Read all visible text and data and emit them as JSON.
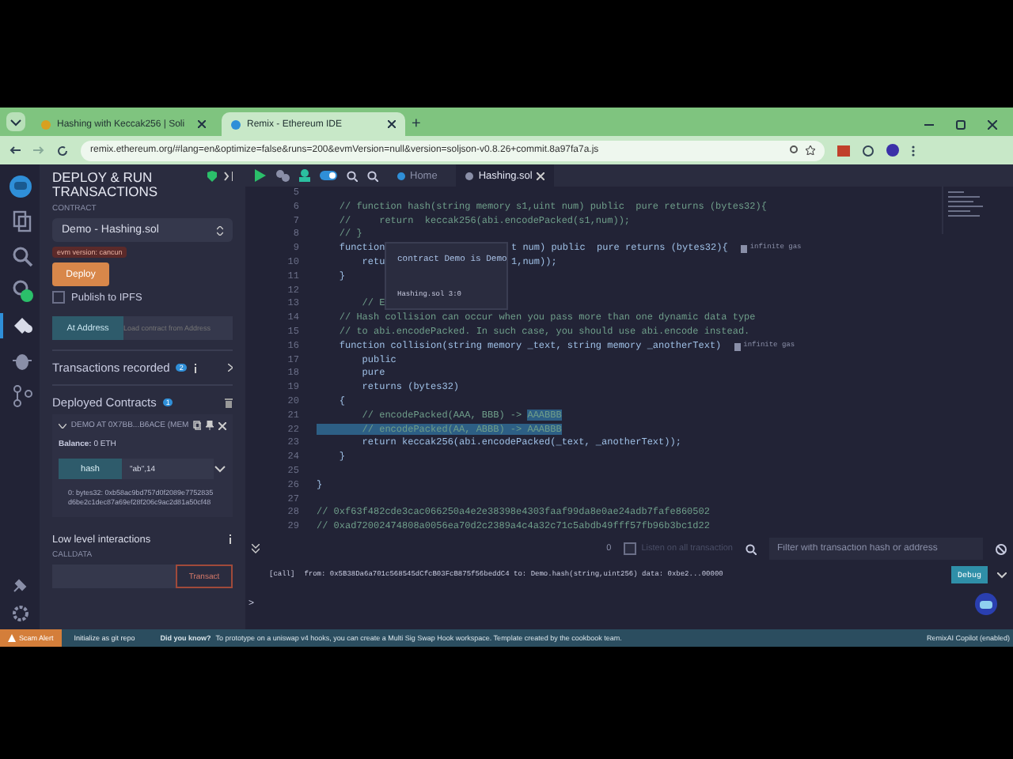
{
  "browser": {
    "tabs": [
      {
        "title": "Hashing with Keccak256 | Soli",
        "selected": false
      },
      {
        "title": "Remix - Ethereum IDE",
        "selected": true
      }
    ],
    "new_tab": "+",
    "url": "remix.ethereum.org/#lang=en&optimize=false&runs=200&evmVersion=null&version=soljson-v0.8.26+commit.8a97fa7a.js"
  },
  "activity_bar": [
    {
      "kind": "files",
      "selected": false
    },
    {
      "kind": "search",
      "selected": false
    },
    {
      "kind": "compiler",
      "selected": false
    },
    {
      "kind": "deploy",
      "selected": true
    },
    {
      "kind": "debug",
      "selected": false
    },
    {
      "kind": "git",
      "selected": false
    }
  ],
  "panel": {
    "title": "DEPLOY & RUN TRANSACTIONS",
    "contract_label": "CONTRACT",
    "contract": "Demo - Hashing.sol",
    "evm_badge": "evm version: cancun",
    "deploy_button": "Deploy",
    "publish": {
      "label": "Publish to IPFS",
      "checked": false
    },
    "at_address_button": "At Address",
    "load_placeholder": "Load contract from Address",
    "transactions_recorded": {
      "label": "Transactions recorded",
      "count": "2"
    },
    "deployed": {
      "label": "Deployed Contracts",
      "count": "1"
    },
    "instance": {
      "title": "DEMO AT 0X7BB...B6ACE (MEM",
      "balance": "**Balance:** 0 ETH",
      "function": "hash",
      "args": "\"ab\",14",
      "output": "0: bytes32: 0xb58ac9bd757d0f2089e7752835d6be2c1dec87a69ef28f206c9ac2d81a50cf48"
    },
    "low_level": {
      "title": "Low level interactions",
      "calldata_label": "CALLDATA",
      "button": "Transact"
    }
  },
  "editor": {
    "tabs": [
      {
        "label": "Home",
        "selected": false
      },
      {
        "label": "Hashing.sol",
        "selected": true
      }
    ],
    "toggle": {
      "on": true
    },
    "lines": [
      {
        "number": "5",
        "kind": "code"
      },
      {
        "number": "6",
        "kind": "comment",
        "text": "    // function hash(string memory s1,uint num) public  pure returns (bytes32){"
      },
      {
        "number": "7",
        "kind": "comment",
        "text": "    //     return  keccak256(abi.encodePacked(s1,num));"
      },
      {
        "number": "8",
        "kind": "comment",
        "text": "    // }"
      },
      {
        "number": "9",
        "kind": "code",
        "text": "    function",
        "text_after": "t num) public  pure returns (bytes32){",
        "gas": "infinite gas"
      },
      {
        "number": "10",
        "kind": "code",
        "text": "        retu",
        "text_after": "1,num));"
      },
      {
        "number": "11",
        "kind": "code",
        "text": "    }"
      },
      {
        "number": "12",
        "kind": "code"
      },
      {
        "number": "13",
        "kind": "comment",
        "text": "        // E"
      },
      {
        "number": "14",
        "kind": "comment",
        "text": "    // Hash collision can occur when you pass more than one dynamic data type"
      },
      {
        "number": "15",
        "kind": "comment",
        "text": "    // to abi.encodePacked. In such case, you should use abi.encode instead."
      },
      {
        "number": "16",
        "kind": "code",
        "text": "    function collision(string memory _text, string memory _anotherText)",
        "gas": "infinite gas"
      },
      {
        "number": "17",
        "kind": "code",
        "text": "        public"
      },
      {
        "number": "18",
        "kind": "code",
        "text": "        pure"
      },
      {
        "number": "19",
        "kind": "code",
        "text": "        returns (bytes32)"
      },
      {
        "number": "20",
        "kind": "code",
        "text": "    {"
      },
      {
        "number": "21",
        "kind": "comment",
        "text": "        // encodePacked(AAA, BBB) -> ",
        "selected_text": "AAABBB"
      },
      {
        "number": "22",
        "kind": "comment",
        "selected_text": "        // encodePacked(AA, ABBB) -> AAABBB"
      },
      {
        "number": "23",
        "kind": "code",
        "text": "        return keccak256(abi.encodePacked(_text, _anotherText));"
      },
      {
        "number": "24",
        "kind": "code",
        "text": "    }"
      },
      {
        "number": "25",
        "kind": "code"
      },
      {
        "number": "26",
        "kind": "code",
        "text": "}"
      },
      {
        "number": "27",
        "kind": "code"
      },
      {
        "number": "28",
        "kind": "comment",
        "text": "// 0xf63f482cde3cac066250a4e2e38398e4303faaf99da8e0ae24adb7fafe860502"
      },
      {
        "number": "29",
        "kind": "comment",
        "text": "// 0xad72002474808a0056ea70d2c2389a4c4a32c71c5abdb49fff57fb96b3bc1d22"
      }
    ],
    "tooltip": {
      "title": "contract Demo is Demo",
      "location": "Hashing.sol 3:0"
    }
  },
  "terminal": {
    "count": "0",
    "listen": {
      "label": "Listen on all transaction",
      "checked": false
    },
    "filter_placeholder": "Filter with transaction hash or address",
    "logs": [
      {
        "tag": "[call]",
        "text": "from: 0x5B38Da6a701c568545dCfcB03FcB875f56beddC4 to: Demo.hash(string,uint256) data: 0xbe2...00000",
        "button": "Debug"
      }
    ],
    "prompt": ">"
  },
  "status_bar": {
    "alert": "Scam Alert",
    "git": "Initialize as git repo",
    "tip_title": "Did you know?",
    "tip": "To prototype on a uniswap v4 hooks, you can create a Multi Sig Swap Hook workspace. Template created by the cookbook team.",
    "copilot": "RemixAI Copilot (enabled)"
  }
}
